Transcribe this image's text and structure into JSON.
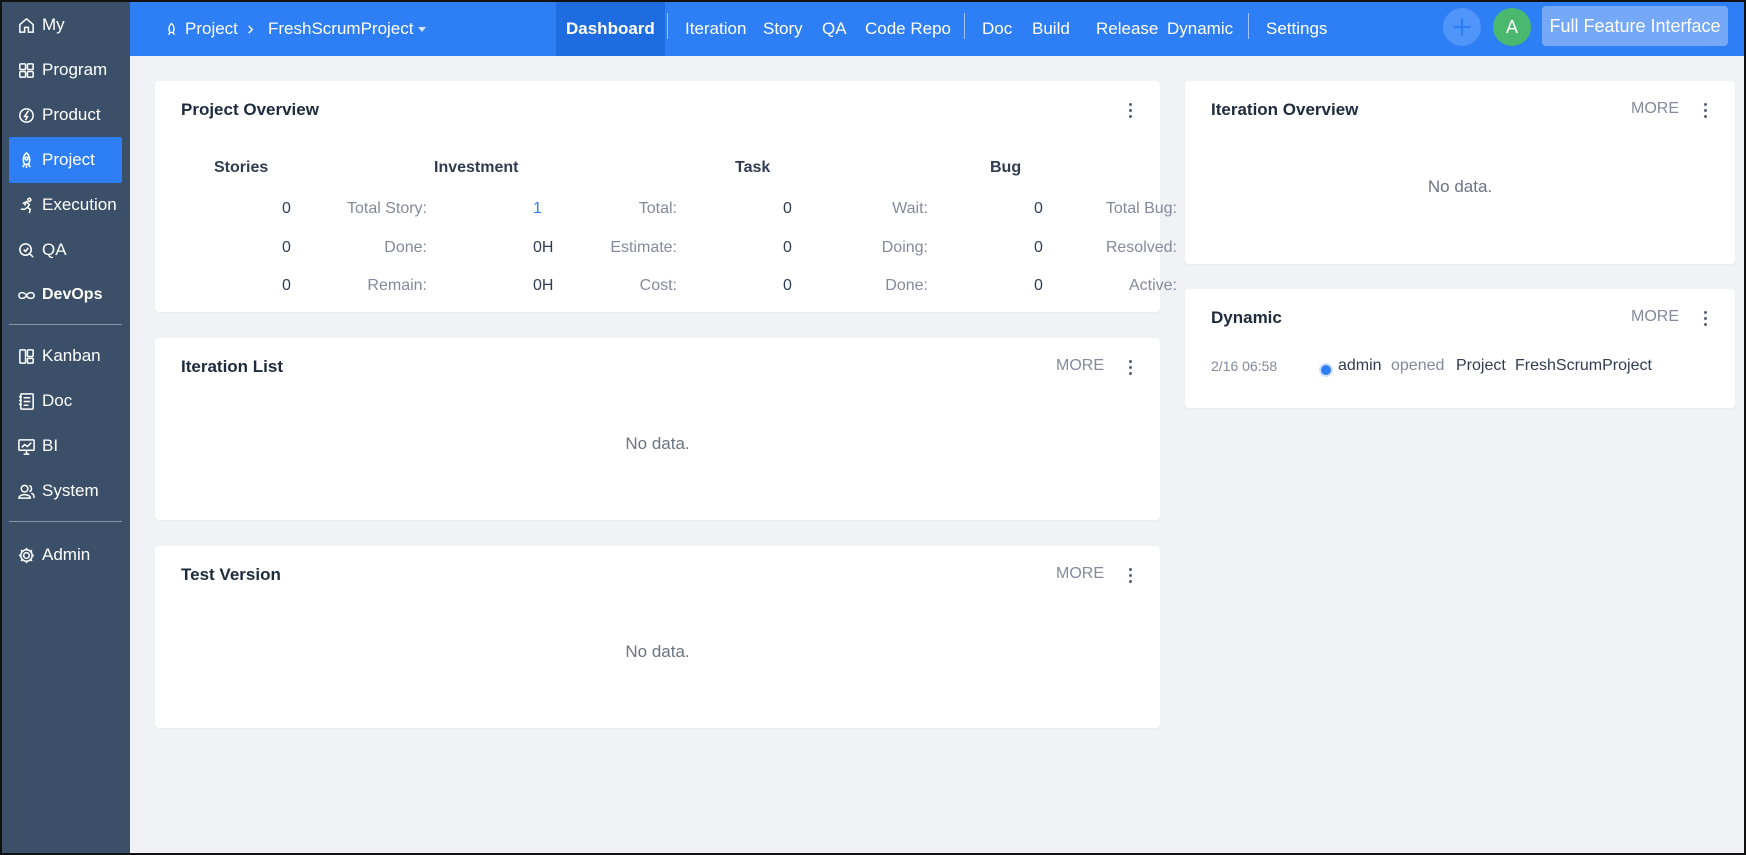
{
  "sidebar": {
    "items": [
      {
        "label": "My",
        "icon": "home-icon"
      },
      {
        "label": "Program",
        "icon": "grid-icon"
      },
      {
        "label": "Product",
        "icon": "product-icon"
      },
      {
        "label": "Project",
        "icon": "rocket-icon",
        "active": true
      },
      {
        "label": "Execution",
        "icon": "run-icon"
      },
      {
        "label": "QA",
        "icon": "qa-icon"
      },
      {
        "label": "DevOps",
        "icon": "infinity-icon"
      },
      {
        "label": "Kanban",
        "icon": "kanban-icon"
      },
      {
        "label": "Doc",
        "icon": "doc-icon"
      },
      {
        "label": "BI",
        "icon": "monitor-icon"
      },
      {
        "label": "System",
        "icon": "users-icon"
      },
      {
        "label": "Admin",
        "icon": "gear-icon"
      }
    ]
  },
  "header": {
    "breadcrumb_root": "Project",
    "breadcrumb_project": "FreshScrumProject",
    "nav": [
      "Dashboard",
      "Iteration",
      "Story",
      "QA",
      "Code Repo",
      "Doc",
      "Build",
      "Release",
      "Dynamic",
      "Settings"
    ],
    "active_nav": "Dashboard",
    "avatar_letter": "A",
    "full_feature_label": "Full Feature Interface"
  },
  "project_overview": {
    "title": "Project Overview",
    "columns": [
      {
        "heading": "Stories",
        "rows": [
          {
            "label": "Total Story:",
            "value": "0"
          },
          {
            "label": "Done:",
            "value": "0"
          },
          {
            "label": "Remain:",
            "value": "0"
          }
        ]
      },
      {
        "heading": "Investment",
        "rows": [
          {
            "label": "Total:",
            "value": "1"
          },
          {
            "label": "Estimate:",
            "value": "0H"
          },
          {
            "label": "Cost:",
            "value": "0H"
          }
        ]
      },
      {
        "heading": "Task",
        "rows": [
          {
            "label": "Wait:",
            "value": "0"
          },
          {
            "label": "Doing:",
            "value": "0"
          },
          {
            "label": "Done:",
            "value": "0"
          }
        ]
      },
      {
        "heading": "Bug",
        "rows": [
          {
            "label": "Total Bug:",
            "value": "0"
          },
          {
            "label": "Resolved:",
            "value": "0"
          },
          {
            "label": "Active:",
            "value": "0"
          }
        ]
      }
    ]
  },
  "iteration_list": {
    "title": "Iteration List",
    "more": "MORE",
    "empty": "No data."
  },
  "test_version": {
    "title": "Test Version",
    "more": "MORE",
    "empty": "No data."
  },
  "iteration_overview": {
    "title": "Iteration Overview",
    "more": "MORE",
    "empty": "No data."
  },
  "dynamic": {
    "title": "Dynamic",
    "more": "MORE",
    "entries": [
      {
        "time": "2/16 06:58",
        "user": "admin",
        "action": "opened",
        "object_type": "Project",
        "object_name": "FreshScrumProject"
      }
    ]
  },
  "colors": {
    "accent": "#2e7ef5",
    "sidebar": "#3b5068",
    "avatar": "#4bb86f"
  }
}
